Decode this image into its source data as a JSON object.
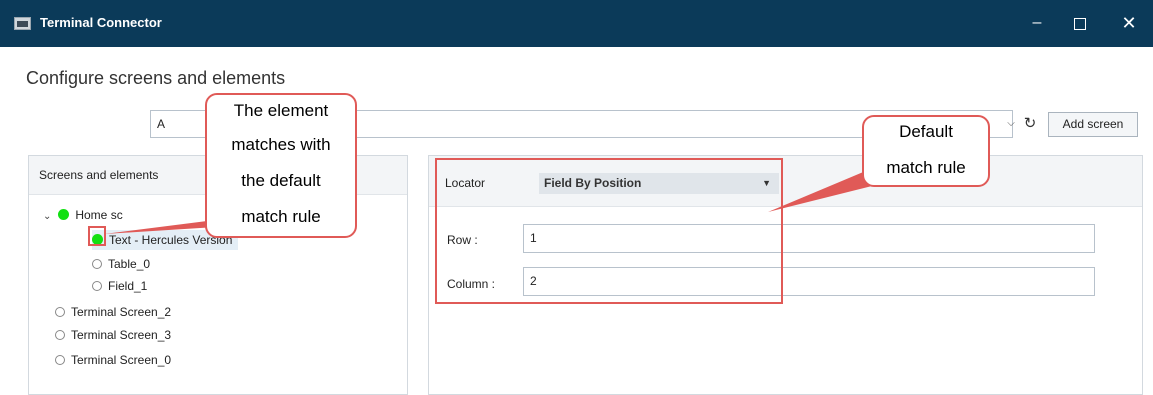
{
  "window": {
    "title": "Terminal Connector",
    "minimize": "–",
    "close": "✕"
  },
  "header": {
    "section_title": "Configure screens and elements",
    "screen_value": "A",
    "dropdown_arrow": "⌵",
    "refresh_icon": "↻",
    "add_screen_label": "Add screen"
  },
  "tree": {
    "header": "Screens and elements",
    "home_label": "Home sc",
    "items": [
      {
        "label": "Text - Hercules Version",
        "status": "matched"
      },
      {
        "label": "Table_0",
        "status": "none"
      },
      {
        "label": "Field_1",
        "status": "none"
      }
    ],
    "screens": [
      "Terminal Screen_2",
      "Terminal Screen_3",
      "Terminal Screen_0"
    ]
  },
  "properties": {
    "locator_label": "Locator",
    "locator_value": "Field By Position",
    "row_label": "Row :",
    "row_value": "1",
    "column_label": "Column :",
    "column_value": "2"
  },
  "annotations": {
    "left_callout": [
      "The element",
      "matches with",
      "the default",
      "match rule"
    ],
    "right_callout": [
      "Default",
      "match rule"
    ],
    "color": "#e05a57"
  },
  "colors": {
    "titlebar": "#0b3a59",
    "match_green": "#12e012"
  }
}
